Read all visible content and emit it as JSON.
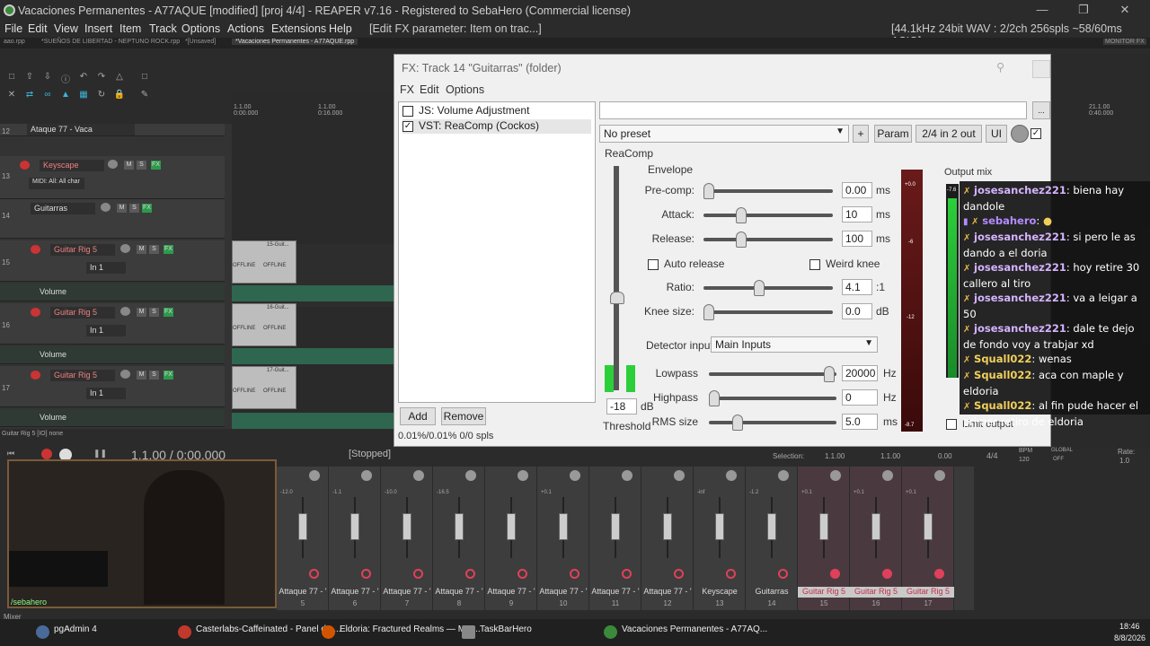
{
  "window": {
    "title": "Vacaciones Permanentes - A77AQUE [modified] [proj 4/4] - REAPER v7.16 - Registered to SebaHero (Commercial license)"
  },
  "menu": {
    "items": [
      "File",
      "Edit",
      "View",
      "Insert",
      "Item",
      "Track",
      "Options",
      "Actions",
      "Extensions",
      "Help"
    ],
    "action_hint": "[Edit FX parameter: Item on trac...]",
    "audio_status": "[44.1kHz 24bit WAV : 2/2ch 256spls ~58/60ms ASIO]"
  },
  "project_tabs": [
    "aao.rpp",
    "*SUEÑOS DE LIBERTAD - NEPTUNO ROCK.rpp",
    "*[Unsaved]",
    "*Vacaciones Permanentes - A77AQUE.rpp"
  ],
  "monitor_fx": "MONITOR FX",
  "tracks": [
    {
      "num": "12",
      "name": "Ataque 77 - Vaca"
    },
    {
      "num": "13",
      "name": "Keyscape",
      "midi": "MIDI: All: All char"
    },
    {
      "num": "14",
      "name": "Guitarras"
    },
    {
      "num": "15",
      "name": "Guitar Rig 5",
      "input": "In 1",
      "envelope": "Volume"
    },
    {
      "num": "16",
      "name": "Guitar Rig 5",
      "input": "In 1",
      "envelope": "Volume"
    },
    {
      "num": "17",
      "name": "Guitar Rig 5",
      "input": "In 1",
      "envelope": "Volume"
    }
  ],
  "timeline": {
    "marker1": "1.1.00",
    "marker1b": "0:00.000",
    "marker2": "1.1.00",
    "marker2b": "0:16.000",
    "marker3": "21.1.00",
    "marker3b": "0:40.000"
  },
  "items": [
    {
      "name": "15-Guit...",
      "offline": "OFFLINE"
    },
    {
      "name": "16-Guit...",
      "offline": "OFFLINE"
    },
    {
      "name": "17-Guit...",
      "offline": "OFFLINE"
    }
  ],
  "transport": {
    "track_info": "Guitar Rig 5 [IO] none",
    "position": "1.1.00 / 0:00.000",
    "status": "[Stopped]",
    "selection_label": "Selection:",
    "sel_start": "1.1.00",
    "sel_end": "1.1.00",
    "sel_len": "0.00",
    "time_sig": "4/4",
    "bpm_label": "BPM",
    "bpm": "120",
    "rate_label": "Rate:",
    "rate": "1.0",
    "global": "GLOBAL",
    "global_state": "OFF"
  },
  "fx": {
    "title": "FX: Track 14 \"Guitarras\" (folder)",
    "menu": [
      "FX",
      "Edit",
      "Options"
    ],
    "chain": [
      {
        "label": "JS: Volume Adjustment",
        "checked": false
      },
      {
        "label": "VST: ReaComp (Cockos)",
        "checked": true
      }
    ],
    "add_label": "Add",
    "remove_label": "Remove",
    "cpu": "0.01%/0.01% 0/0 spls",
    "preset": "No preset",
    "plus": "+",
    "param_label": "Param",
    "io_label": "2/4 in 2 out",
    "ui_label": "UI",
    "plugin_name": "ReaComp",
    "envelope_header": "Envelope",
    "params": {
      "precomp": {
        "label": "Pre-comp:",
        "value": "0.00",
        "unit": "ms"
      },
      "attack": {
        "label": "Attack:",
        "value": "10",
        "unit": "ms"
      },
      "release": {
        "label": "Release:",
        "value": "100",
        "unit": "ms"
      },
      "ratio": {
        "label": "Ratio:",
        "value": "4.1",
        "unit": ":1"
      },
      "knee": {
        "label": "Knee size:",
        "value": "0.0",
        "unit": "dB"
      },
      "lowpass": {
        "label": "Lowpass",
        "value": "20000",
        "unit": "Hz"
      },
      "highpass": {
        "label": "Highpass",
        "value": "0",
        "unit": "Hz"
      },
      "rms": {
        "label": "RMS size",
        "value": "5.0",
        "unit": "ms"
      }
    },
    "auto_release": "Auto release",
    "weird_knee": "Weird knee",
    "detector_label": "Detector input:",
    "detector_value": "Main Inputs",
    "threshold_value": "-18",
    "threshold_unit": "dB",
    "threshold_label": "Threshold",
    "output_mix": "Output mix",
    "limit_output": "Limit output",
    "meter_ticks": [
      "+0.0",
      "-6",
      "-12",
      "-8.7"
    ],
    "out_meter_tick": "-7.6"
  },
  "chat": [
    {
      "user": "josesanchez221",
      "msg": "biena hay dandole"
    },
    {
      "user": "sebahero",
      "msg": ""
    },
    {
      "user": "josesanchez221",
      "msg": "si pero le as dando a el doria"
    },
    {
      "user": "josesanchez221",
      "msg": "hoy retire 30 callero al tiro"
    },
    {
      "user": "josesanchez221",
      "msg": "va a leigar a 50"
    },
    {
      "user": "josesanchez221",
      "msg": "dale te dejo de fondo voy a trabjar xd"
    },
    {
      "user": "Squall022",
      "msg": "wenas"
    },
    {
      "user": "Squall022",
      "msg": "aca con maple y eldoria"
    },
    {
      "user": "Squall022",
      "msg": "al fin pude hacer el primer retiro de eldoria"
    }
  ],
  "mixer": {
    "label": "Mixer",
    "strips": [
      {
        "name": "Attaque 77 - '",
        "num": "5",
        "db": "-12.0"
      },
      {
        "name": "Attaque 77 - '",
        "num": "6",
        "db": "-1.1"
      },
      {
        "name": "Attaque 77 - '",
        "num": "7",
        "db": "-10.0"
      },
      {
        "name": "Attaque 77 - '",
        "num": "8",
        "db": "-16.5"
      },
      {
        "name": "Attaque 77 - '",
        "num": "9",
        "db": ""
      },
      {
        "name": "Attaque 77 - '",
        "num": "10",
        "db": "+0.1"
      },
      {
        "name": "Attaque 77 - '",
        "num": "11",
        "db": ""
      },
      {
        "name": "Attaque 77 - '",
        "num": "12",
        "db": ""
      },
      {
        "name": "Keyscape",
        "num": "13",
        "db": "-inf"
      },
      {
        "name": "Guitarras",
        "num": "14",
        "db": "-1.2"
      },
      {
        "name": "Guitar Rig 5",
        "num": "15",
        "db": "+0.1"
      },
      {
        "name": "Guitar Rig 5",
        "num": "16",
        "db": "+0.1"
      },
      {
        "name": "Guitar Rig 5",
        "num": "17",
        "db": "+0.1"
      }
    ]
  },
  "webcam_overlay": "/sebahero",
  "taskbar": {
    "apps": [
      "pgAdmin 4",
      "Casterlabs-Caffeinated - Panel de ...",
      "Eldoria: Fractured Realms — MM...",
      "TaskBarHero",
      "Vacaciones Permanentes - A77AQ..."
    ],
    "time": "18:46",
    "date": "8/8/2026"
  }
}
